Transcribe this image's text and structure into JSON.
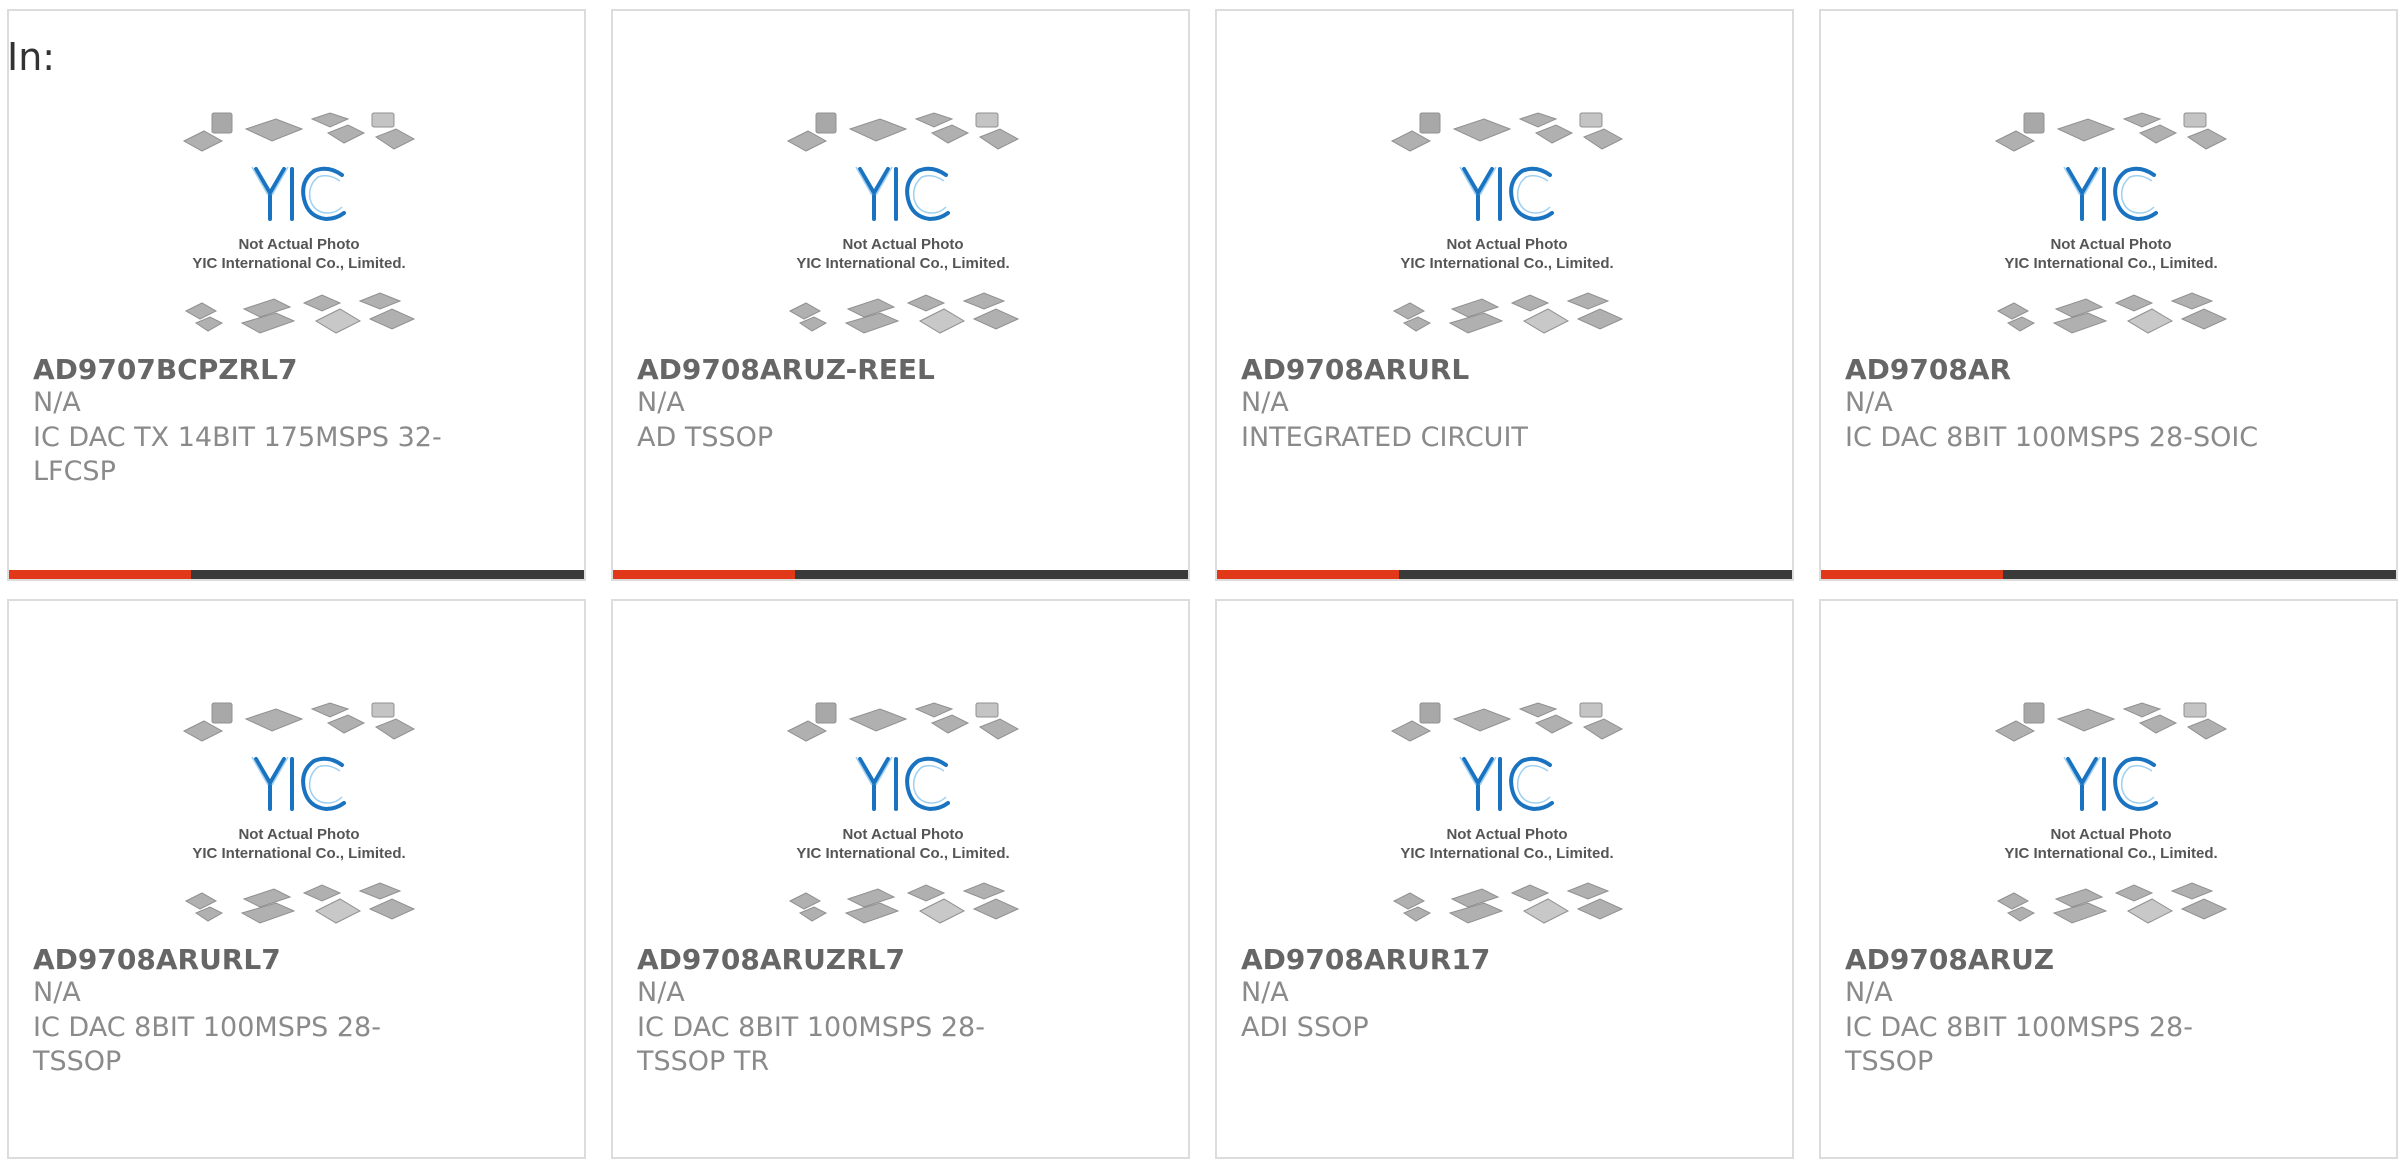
{
  "header": {
    "label": "In:"
  },
  "placeholder": {
    "logo_text": "YIC",
    "line1": "Not Actual Photo",
    "line2": "YIC International Co., Limited.",
    "accent_color": "#e2381a",
    "logo_color": "#1a73c0"
  },
  "products": [
    {
      "part": "AD9707BCPZRL7",
      "mfr": "N/A",
      "desc": "IC DAC TX 14BIT 175MSPS 32-LFCSP"
    },
    {
      "part": "AD9708ARUZ-REEL",
      "mfr": "N/A",
      "desc": "AD TSSOP"
    },
    {
      "part": "AD9708ARURL",
      "mfr": "N/A",
      "desc": "INTEGRATED CIRCUIT"
    },
    {
      "part": "AD9708AR",
      "mfr": "N/A",
      "desc": "IC DAC 8BIT 100MSPS 28-SOIC"
    },
    {
      "part": "AD9708ARURL7",
      "mfr": "N/A",
      "desc": "IC DAC 8BIT 100MSPS 28-TSSOP"
    },
    {
      "part": "AD9708ARUZRL7",
      "mfr": "N/A",
      "desc": "IC DAC 8BIT 100MSPS 28-TSSOP TR"
    },
    {
      "part": "AD9708ARUR17",
      "mfr": "N/A",
      "desc": "ADI SSOP"
    },
    {
      "part": "AD9708ARUZ",
      "mfr": "N/A",
      "desc": "IC DAC 8BIT 100MSPS 28-TSSOP"
    }
  ]
}
